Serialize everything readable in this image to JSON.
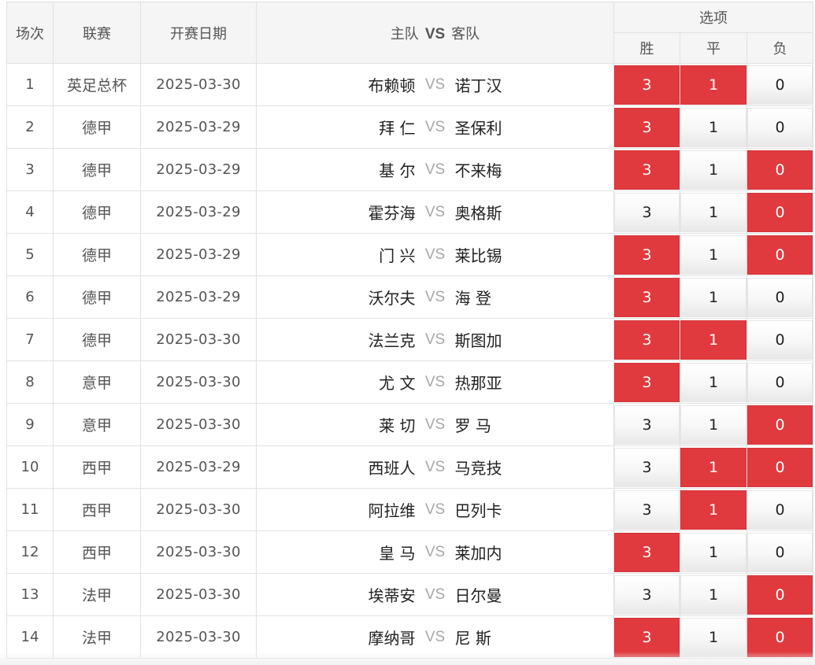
{
  "header": {
    "round": "场次",
    "league": "联赛",
    "date": "开赛日期",
    "home": "主队",
    "vs": "VS",
    "away": "客队",
    "options": "选项",
    "win": "胜",
    "draw": "平",
    "loss": "负"
  },
  "colors": {
    "selected": "#e03a3f",
    "border": "#e1e1e1",
    "header_bg": "#f5f5f5"
  },
  "rows": [
    {
      "num": "1",
      "league": "英足总杯",
      "date": "2025-03-30",
      "home": "布赖顿",
      "vs": "VS",
      "away": "诺丁汉",
      "win": "3",
      "draw": "1",
      "loss": "0",
      "sel_win": true,
      "sel_draw": true,
      "sel_loss": false
    },
    {
      "num": "2",
      "league": "德甲",
      "date": "2025-03-29",
      "home": "拜 仁",
      "vs": "VS",
      "away": "圣保利",
      "win": "3",
      "draw": "1",
      "loss": "0",
      "sel_win": true,
      "sel_draw": false,
      "sel_loss": false
    },
    {
      "num": "3",
      "league": "德甲",
      "date": "2025-03-29",
      "home": "基 尔",
      "vs": "VS",
      "away": "不来梅",
      "win": "3",
      "draw": "1",
      "loss": "0",
      "sel_win": true,
      "sel_draw": false,
      "sel_loss": true
    },
    {
      "num": "4",
      "league": "德甲",
      "date": "2025-03-29",
      "home": "霍芬海",
      "vs": "VS",
      "away": "奥格斯",
      "win": "3",
      "draw": "1",
      "loss": "0",
      "sel_win": false,
      "sel_draw": false,
      "sel_loss": true
    },
    {
      "num": "5",
      "league": "德甲",
      "date": "2025-03-29",
      "home": "门 兴",
      "vs": "VS",
      "away": "莱比锡",
      "win": "3",
      "draw": "1",
      "loss": "0",
      "sel_win": true,
      "sel_draw": false,
      "sel_loss": true
    },
    {
      "num": "6",
      "league": "德甲",
      "date": "2025-03-29",
      "home": "沃尔夫",
      "vs": "VS",
      "away": "海 登",
      "win": "3",
      "draw": "1",
      "loss": "0",
      "sel_win": true,
      "sel_draw": false,
      "sel_loss": false
    },
    {
      "num": "7",
      "league": "德甲",
      "date": "2025-03-30",
      "home": "法兰克",
      "vs": "VS",
      "away": "斯图加",
      "win": "3",
      "draw": "1",
      "loss": "0",
      "sel_win": true,
      "sel_draw": true,
      "sel_loss": false
    },
    {
      "num": "8",
      "league": "意甲",
      "date": "2025-03-30",
      "home": "尤 文",
      "vs": "VS",
      "away": "热那亚",
      "win": "3",
      "draw": "1",
      "loss": "0",
      "sel_win": true,
      "sel_draw": false,
      "sel_loss": false
    },
    {
      "num": "9",
      "league": "意甲",
      "date": "2025-03-30",
      "home": "莱 切",
      "vs": "VS",
      "away": "罗 马",
      "win": "3",
      "draw": "1",
      "loss": "0",
      "sel_win": false,
      "sel_draw": false,
      "sel_loss": true
    },
    {
      "num": "10",
      "league": "西甲",
      "date": "2025-03-29",
      "home": "西班人",
      "vs": "VS",
      "away": "马竞技",
      "win": "3",
      "draw": "1",
      "loss": "0",
      "sel_win": false,
      "sel_draw": true,
      "sel_loss": true
    },
    {
      "num": "11",
      "league": "西甲",
      "date": "2025-03-30",
      "home": "阿拉维",
      "vs": "VS",
      "away": "巴列卡",
      "win": "3",
      "draw": "1",
      "loss": "0",
      "sel_win": false,
      "sel_draw": true,
      "sel_loss": false
    },
    {
      "num": "12",
      "league": "西甲",
      "date": "2025-03-30",
      "home": "皇 马",
      "vs": "VS",
      "away": "莱加内",
      "win": "3",
      "draw": "1",
      "loss": "0",
      "sel_win": true,
      "sel_draw": false,
      "sel_loss": false
    },
    {
      "num": "13",
      "league": "法甲",
      "date": "2025-03-30",
      "home": "埃蒂安",
      "vs": "VS",
      "away": "日尔曼",
      "win": "3",
      "draw": "1",
      "loss": "0",
      "sel_win": false,
      "sel_draw": false,
      "sel_loss": true
    },
    {
      "num": "14",
      "league": "法甲",
      "date": "2025-03-30",
      "home": "摩纳哥",
      "vs": "VS",
      "away": "尼 斯",
      "win": "3",
      "draw": "1",
      "loss": "0",
      "sel_win": true,
      "sel_draw": false,
      "sel_loss": true
    }
  ]
}
